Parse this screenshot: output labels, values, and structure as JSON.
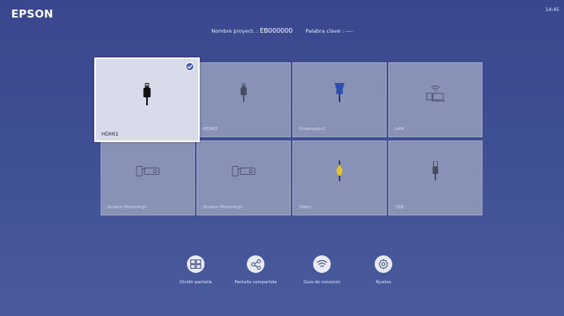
{
  "header": {
    "brand": "EPSON",
    "time": "14:45",
    "projector_name_label": "Nombre proyect. :",
    "projector_name_value": "EB000000",
    "keyword_label": "Palabra clave :",
    "keyword_value": "----"
  },
  "sources": [
    {
      "label": "HDMI1",
      "icon": "hdmi-plug-icon",
      "selected": true
    },
    {
      "label": "HDMI2",
      "icon": "hdmi-plug-icon",
      "selected": false
    },
    {
      "label": "Ordenador1",
      "icon": "vga-plug-icon",
      "selected": false
    },
    {
      "label": "LAN",
      "icon": "lan-computer-icon",
      "selected": false
    },
    {
      "label": "Screen Mirroring1",
      "icon": "phone-projector-icon",
      "selected": false
    },
    {
      "label": "Screen Mirroring2",
      "icon": "phone-projector-icon",
      "selected": false
    },
    {
      "label": "Video",
      "icon": "rca-plug-icon",
      "selected": false
    },
    {
      "label": "USB",
      "icon": "usb-plug-icon",
      "selected": false
    }
  ],
  "toolbar": {
    "split_screen": "Dividir pantalla",
    "screen_share": "Pantalla compartida",
    "connection_guide": "Guía de conexión",
    "settings": "Ajustes"
  },
  "colors": {
    "background": "#3f4f93",
    "tile": "#8891b6",
    "tile_selected": "#d8dbea",
    "check": "#3f55b0"
  }
}
